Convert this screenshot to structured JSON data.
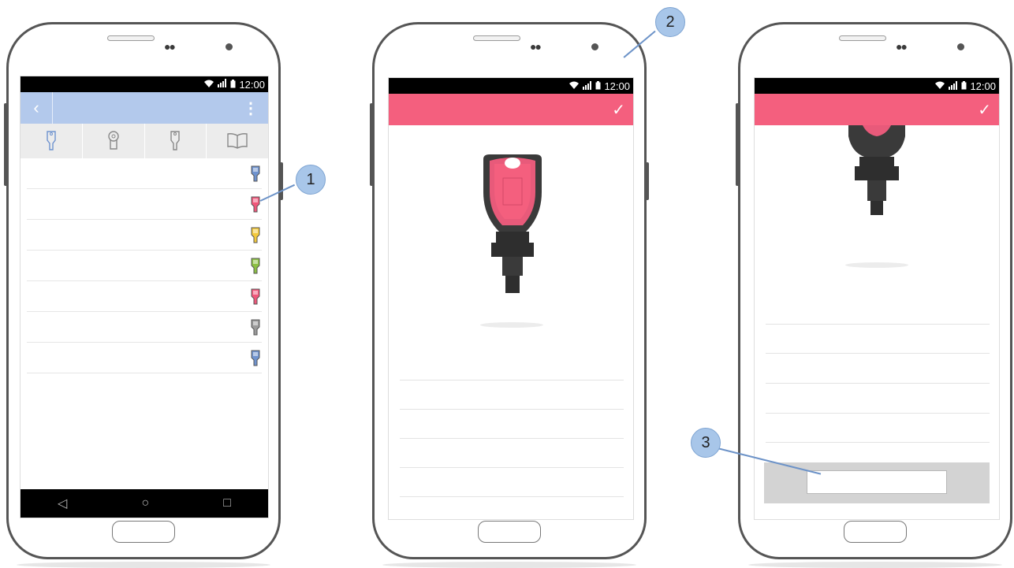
{
  "status_bar": {
    "time": "12:00",
    "wifi_icon": "wifi-icon",
    "signal_icon": "signal-icon",
    "battery_icon": "battery-icon"
  },
  "phone1": {
    "appbar": {
      "back_label": "‹",
      "more_label": "⋮",
      "color": "#b3c9ec"
    },
    "tabs": [
      {
        "name": "key-icon",
        "active": true
      },
      {
        "name": "cylinder-icon",
        "active": false
      },
      {
        "name": "keyfob-icon",
        "active": false
      },
      {
        "name": "book-icon",
        "active": false
      }
    ],
    "key_list": [
      {
        "color": "#6f93cf"
      },
      {
        "color": "#f0577a"
      },
      {
        "color": "#f3c93c"
      },
      {
        "color": "#8cc043"
      },
      {
        "color": "#f0577a"
      },
      {
        "color": "#9a9a9a"
      },
      {
        "color": "#6f93cf"
      }
    ],
    "nav": {
      "back": "◁",
      "home": "○",
      "recents": "□"
    }
  },
  "phone2": {
    "appbar": {
      "check_label": "✓",
      "color": "#f45f7e"
    }
  },
  "phone3": {
    "appbar": {
      "check_label": "✓",
      "color": "#f45f7e"
    }
  },
  "callouts": {
    "c1": "1",
    "c2": "2",
    "c3": "3",
    "color": "#a8c6e9"
  }
}
